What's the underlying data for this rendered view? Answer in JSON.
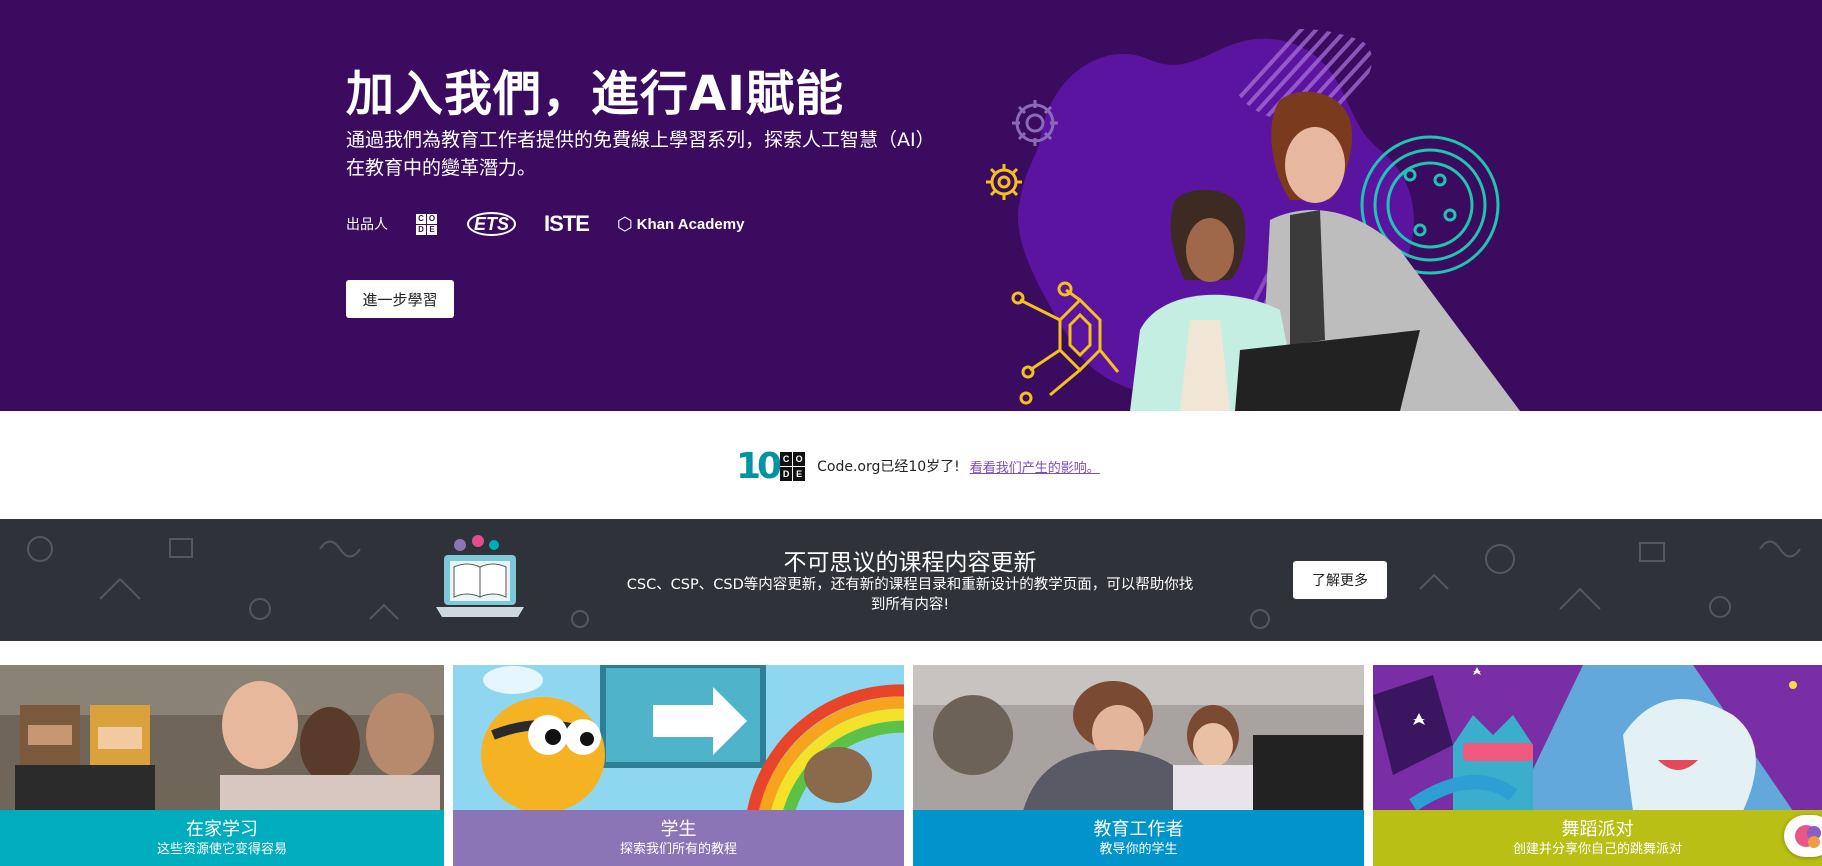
{
  "hero": {
    "title": "加入我們，進行AI賦能",
    "subtitle": "通過我們為教育工作者提供的免費線上學習系列，探索人工智慧（AI）在教育中的變革潛力。",
    "presented_by": "出品人",
    "partners": {
      "code_letters": [
        "C",
        "O",
        "D",
        "E"
      ],
      "ets": "ETS",
      "iste": "ISTE",
      "khan": "Khan Academy"
    },
    "learn_more": "進一步學習"
  },
  "anniversary": {
    "ten": "10",
    "code_letters": [
      "C",
      "O",
      "D",
      "E"
    ],
    "text": "Code.org已经10岁了!",
    "link": "看看我们产生的影响。"
  },
  "banner": {
    "title": "不可思议的课程内容更新",
    "description": "CSC、CSP、CSD等内容更新，还有新的课程目录和重新设计的教学页面，可以帮助你找到所有内容!",
    "button": "了解更多"
  },
  "cards": [
    {
      "title": "在家学习",
      "subtitle": "这些资源使它变得容易",
      "color": "#00adbc"
    },
    {
      "title": "学生",
      "subtitle": "探索我们所有的教程",
      "color": "#8c75b6"
    },
    {
      "title": "教育工作者",
      "subtitle": "教导你的学生",
      "color": "#0094ca"
    },
    {
      "title": "舞蹈派对",
      "subtitle": "创建并分享你自己的跳舞派对",
      "color": "#b9bf15"
    }
  ],
  "colors": {
    "hero_bg": "#3a0b5e",
    "banner_bg": "#2f3238",
    "accent_teal": "#0093a4",
    "link": "#7c4dbd"
  }
}
